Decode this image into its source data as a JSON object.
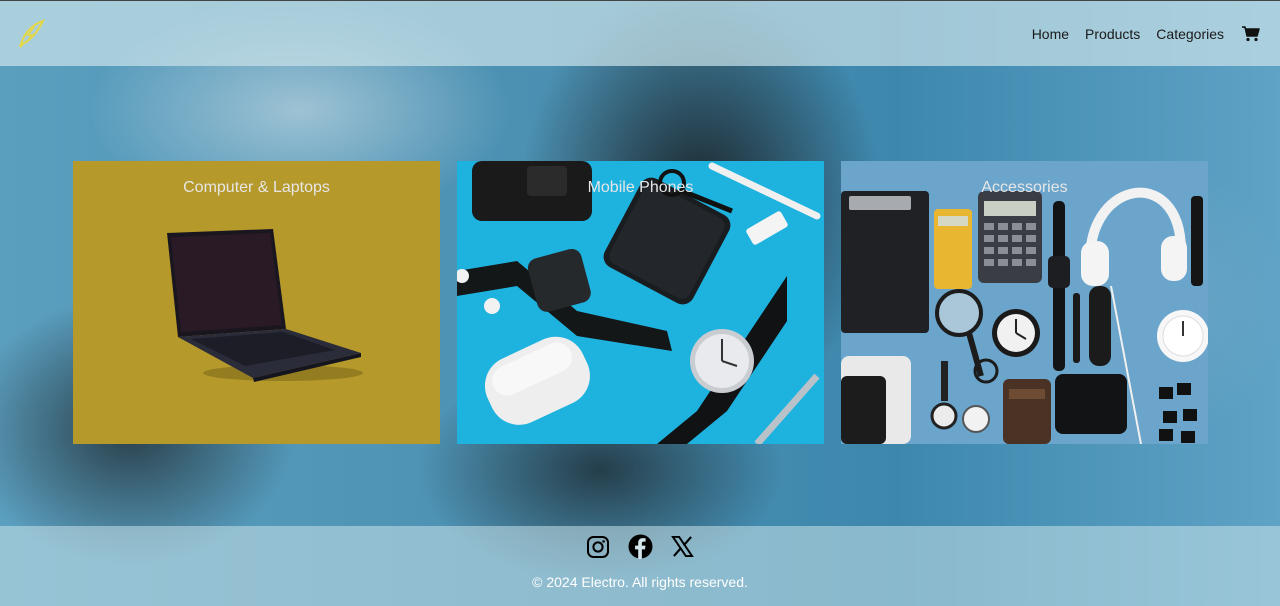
{
  "header": {
    "logo_icon": "lightning-feather-logo",
    "nav": [
      {
        "label": "Home"
      },
      {
        "label": "Products"
      },
      {
        "label": "Categories"
      }
    ],
    "cart_icon": "shopping-cart-icon"
  },
  "categories": [
    {
      "title": "Computer & Laptops",
      "image": "laptop-on-mustard-background",
      "bg_color": "#b5992a"
    },
    {
      "title": "Mobile Phones",
      "image": "smartphone-smartwatch-earbuds-flatlay",
      "bg_color": "#1fb3e0"
    },
    {
      "title": "Accessories",
      "image": "office-accessories-headphones-flatlay",
      "bg_color": "#6aa8cf"
    }
  ],
  "footer": {
    "socials": [
      {
        "icon": "instagram-icon"
      },
      {
        "icon": "facebook-icon"
      },
      {
        "icon": "x-twitter-icon"
      }
    ],
    "copyright": "© 2024 Electro. All rights reserved."
  },
  "colors": {
    "header_bg": "#c8e1e8",
    "logo_yellow": "#e3d84a",
    "text_dark": "#1a1a1a"
  }
}
